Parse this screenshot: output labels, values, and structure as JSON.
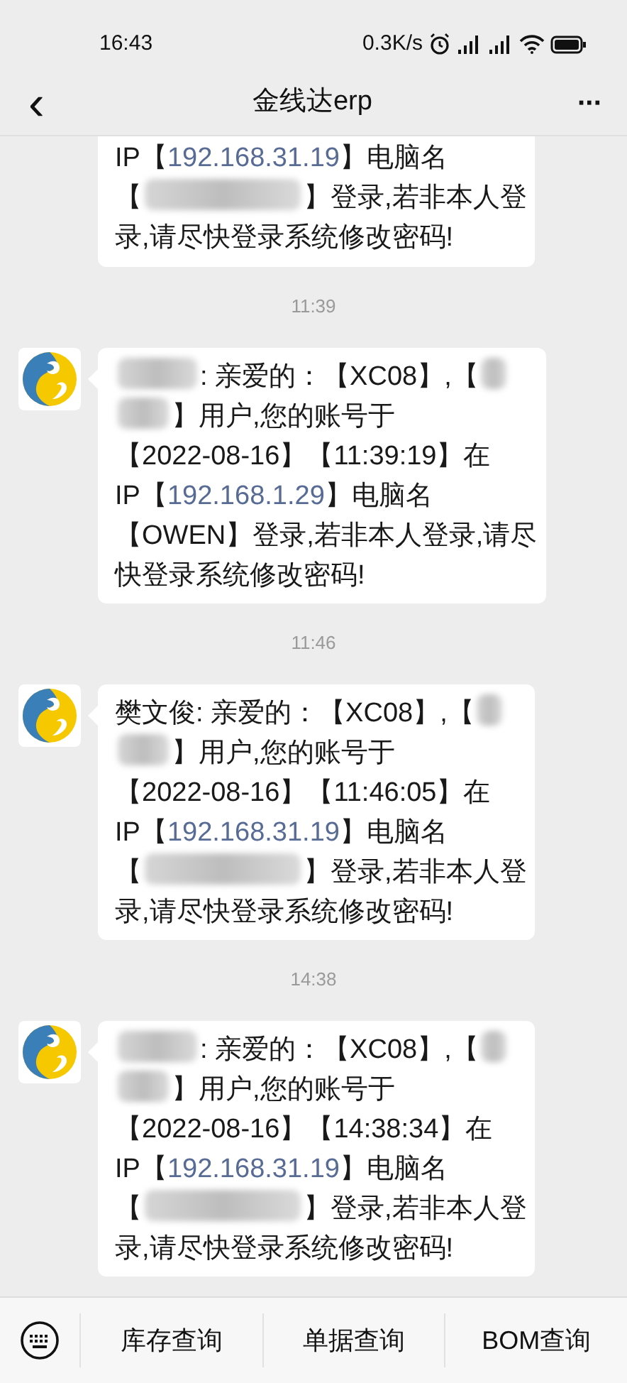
{
  "status_bar": {
    "time": "16:43",
    "net_speed": "0.3K/s"
  },
  "header": {
    "back": "‹",
    "title": "金线达erp",
    "more": "···"
  },
  "messages": [
    {
      "kind": "cut",
      "segments": [
        {
          "kind": "text",
          "text": "IP【"
        },
        {
          "kind": "link",
          "text": "192.168.31.19"
        },
        {
          "kind": "text",
          "text": "】电脑名"
        },
        {
          "kind": "break"
        },
        {
          "kind": "text",
          "text": "【"
        },
        {
          "kind": "redacted"
        },
        {
          "kind": "text",
          "text": "】登录,若非本人登"
        },
        {
          "kind": "break"
        },
        {
          "kind": "text",
          "text": "录,请尽快登录系统修改密码!"
        }
      ]
    },
    {
      "kind": "time",
      "text": "11:39"
    },
    {
      "kind": "bubble",
      "segments": [
        {
          "kind": "redacted"
        },
        {
          "kind": "text",
          "text": ": 亲爱的：【XC08】,【"
        },
        {
          "kind": "redacted"
        },
        {
          "kind": "break"
        },
        {
          "kind": "redacted"
        },
        {
          "kind": "text",
          "text": "】用户,您的账号于"
        },
        {
          "kind": "break"
        },
        {
          "kind": "text",
          "text": "【2022-08-16】【11:39:19】在"
        },
        {
          "kind": "break"
        },
        {
          "kind": "text",
          "text": "IP【"
        },
        {
          "kind": "link",
          "text": "192.168.1.29"
        },
        {
          "kind": "text",
          "text": "】电脑名"
        },
        {
          "kind": "break"
        },
        {
          "kind": "text",
          "text": "【OWEN】登录,若非本人登录,请尽"
        },
        {
          "kind": "break"
        },
        {
          "kind": "text",
          "text": "快登录系统修改密码!"
        }
      ]
    },
    {
      "kind": "time",
      "text": "11:46"
    },
    {
      "kind": "bubble",
      "segments": [
        {
          "kind": "text",
          "text": "樊文俊: 亲爱的：【XC08】,【"
        },
        {
          "kind": "redacted"
        },
        {
          "kind": "break"
        },
        {
          "kind": "redacted"
        },
        {
          "kind": "text",
          "text": "】用户,您的账号于"
        },
        {
          "kind": "break"
        },
        {
          "kind": "text",
          "text": "【2022-08-16】【11:46:05】在"
        },
        {
          "kind": "break"
        },
        {
          "kind": "text",
          "text": "IP【"
        },
        {
          "kind": "link",
          "text": "192.168.31.19"
        },
        {
          "kind": "text",
          "text": "】电脑名"
        },
        {
          "kind": "break"
        },
        {
          "kind": "text",
          "text": "【"
        },
        {
          "kind": "redacted"
        },
        {
          "kind": "text",
          "text": "】登录,若非本人登"
        },
        {
          "kind": "break"
        },
        {
          "kind": "text",
          "text": "录,请尽快登录系统修改密码!"
        }
      ]
    },
    {
      "kind": "time",
      "text": "14:38"
    },
    {
      "kind": "bubble",
      "segments": [
        {
          "kind": "redacted"
        },
        {
          "kind": "text",
          "text": ": 亲爱的：【XC08】,【"
        },
        {
          "kind": "redacted"
        },
        {
          "kind": "break"
        },
        {
          "kind": "redacted"
        },
        {
          "kind": "text",
          "text": "】用户,您的账号于"
        },
        {
          "kind": "break"
        },
        {
          "kind": "text",
          "text": "【2022-08-16】【14:38:34】在"
        },
        {
          "kind": "break"
        },
        {
          "kind": "text",
          "text": "IP【"
        },
        {
          "kind": "link",
          "text": "192.168.31.19"
        },
        {
          "kind": "text",
          "text": "】电脑名"
        },
        {
          "kind": "break"
        },
        {
          "kind": "text",
          "text": "【"
        },
        {
          "kind": "redacted"
        },
        {
          "kind": "text",
          "text": "】登录,若非本人登"
        },
        {
          "kind": "break"
        },
        {
          "kind": "text",
          "text": "录,请尽快登录系统修改密码!"
        }
      ]
    }
  ],
  "menu": [
    "库存查询",
    "单据查询",
    "BOM查询"
  ]
}
